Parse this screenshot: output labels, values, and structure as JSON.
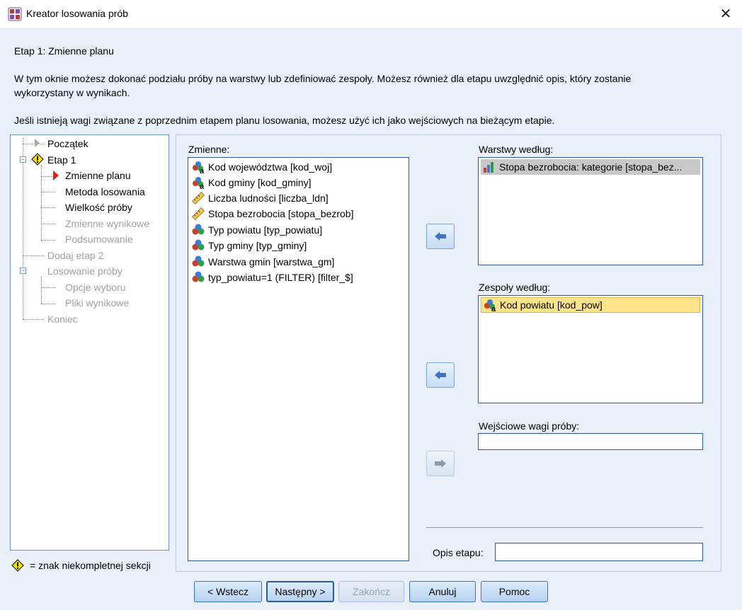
{
  "window": {
    "title": "Kreator losowania prób",
    "close_glyph": "✕"
  },
  "header": {
    "step_title": "Etap 1: Zmienne planu",
    "description_line1": "W tym oknie możesz dokonać podziału próby na warstwy lub zdefiniować zespoły. Możesz również dla etapu uwzględnić opis, który zostanie",
    "description_line2": "wykorzystany w wynikach.",
    "weights_note": "Jeśli istnieją wagi związane z poprzednim etapem planu losowania, możesz użyć ich jako wejściowych na bieżącym etapie."
  },
  "nav": {
    "items": [
      {
        "label": "Początek",
        "state": "done"
      },
      {
        "label": "Etap 1",
        "state": "incomplete"
      },
      {
        "label": "Zmienne planu",
        "state": "current"
      },
      {
        "label": "Metoda losowania",
        "state": "enabled"
      },
      {
        "label": "Wielkość próby",
        "state": "enabled"
      },
      {
        "label": "Zmienne wynikowe",
        "state": "disabled"
      },
      {
        "label": "Podsumowanie",
        "state": "disabled"
      },
      {
        "label": "Dodaj etap 2",
        "state": "disabled"
      },
      {
        "label": "Losowanie próby",
        "state": "disabled"
      },
      {
        "label": "Opcje wyboru",
        "state": "disabled"
      },
      {
        "label": "Pliki wynikowe",
        "state": "disabled"
      },
      {
        "label": "Koniec",
        "state": "disabled"
      }
    ],
    "legend": "= znak niekompletnej sekcji"
  },
  "variables": {
    "label": "Zmienne:",
    "items": [
      {
        "label": "Kod województwa [kod_woj]",
        "icon": "nominal-string-icon"
      },
      {
        "label": "Kod gminy [kod_gminy]",
        "icon": "nominal-string-icon"
      },
      {
        "label": "Liczba ludności [liczba_ldn]",
        "icon": "scale-icon"
      },
      {
        "label": "Stopa bezrobocia [stopa_bezrob]",
        "icon": "scale-icon"
      },
      {
        "label": "Typ powiatu [typ_powiatu]",
        "icon": "nominal-icon"
      },
      {
        "label": "Typ gminy [typ_gminy]",
        "icon": "nominal-icon"
      },
      {
        "label": "Warstwa gmin [warstwa_gm]",
        "icon": "nominal-icon"
      },
      {
        "label": "typ_powiatu=1 (FILTER) [filter_$]",
        "icon": "nominal-icon"
      }
    ]
  },
  "strata": {
    "label": "Warstwy według:",
    "items": [
      {
        "label": "Stopa bezrobocia: kategorie [stopa_bez...",
        "icon": "ordinal-icon"
      }
    ]
  },
  "clusters": {
    "label": "Zespoły według:",
    "items": [
      {
        "label": "Kod powiatu [kod_pow]",
        "icon": "nominal-string-icon"
      }
    ]
  },
  "input_weights": {
    "label": "Wejściowe wagi próby:",
    "value": ""
  },
  "stage_label": {
    "label": "Opis etapu:",
    "value": ""
  },
  "buttons": {
    "back": "< Wstecz",
    "next": "Następny >",
    "finish": "Zakończ",
    "cancel": "Anuluj",
    "help": "Pomoc"
  },
  "colors": {
    "window_bg": "#e9f0f9",
    "selection_gray": "#c8c8c8",
    "selection_yellow": "#fde38a",
    "list_border": "#2b55a5"
  }
}
